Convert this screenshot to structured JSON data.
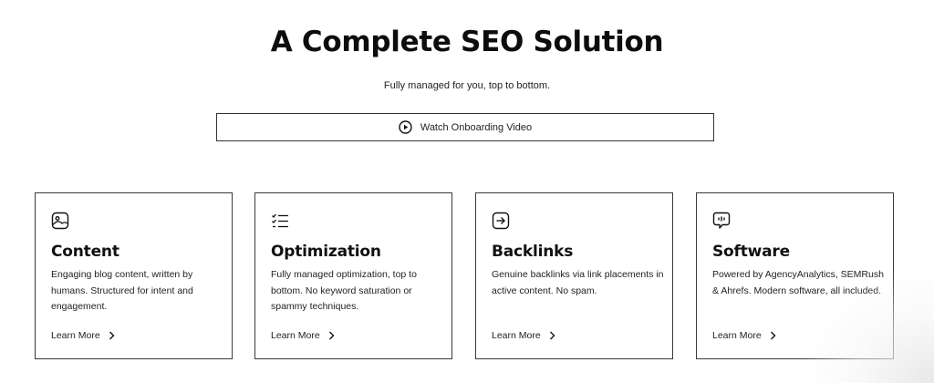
{
  "hero": {
    "title": "A Complete SEO Solution",
    "subtitle": "Fully managed for you, top to bottom.",
    "video_button_label": "Watch Onboarding Video",
    "video_button_icon": "play-circle-icon"
  },
  "cards": [
    {
      "icon": "image-icon",
      "title": "Content",
      "description": "Engaging blog content, written by humans. Structured for intent and engagement.",
      "link_label": "Learn More",
      "link_icon": "chevron-right-icon"
    },
    {
      "icon": "checklist-icon",
      "title": "Optimization",
      "description": "Fully managed optimization, top to bottom. No keyword saturation or spammy techniques.",
      "link_label": "Learn More",
      "link_icon": "chevron-right-icon"
    },
    {
      "icon": "arrow-right-box-icon",
      "title": "Backlinks",
      "description": "Genuine backlinks via link placements in active content. No spam.",
      "link_label": "Learn More",
      "link_icon": "chevron-right-icon"
    },
    {
      "icon": "chat-bubble-icon",
      "title": "Software",
      "description": "Powered by AgencyAnalytics, SEMRush & Ahrefs. Modern software, all included.",
      "link_label": "Learn More",
      "link_icon": "chevron-right-icon"
    }
  ],
  "colors": {
    "text": "#111111",
    "border": "#3a3a3a",
    "background": "#ffffff"
  }
}
